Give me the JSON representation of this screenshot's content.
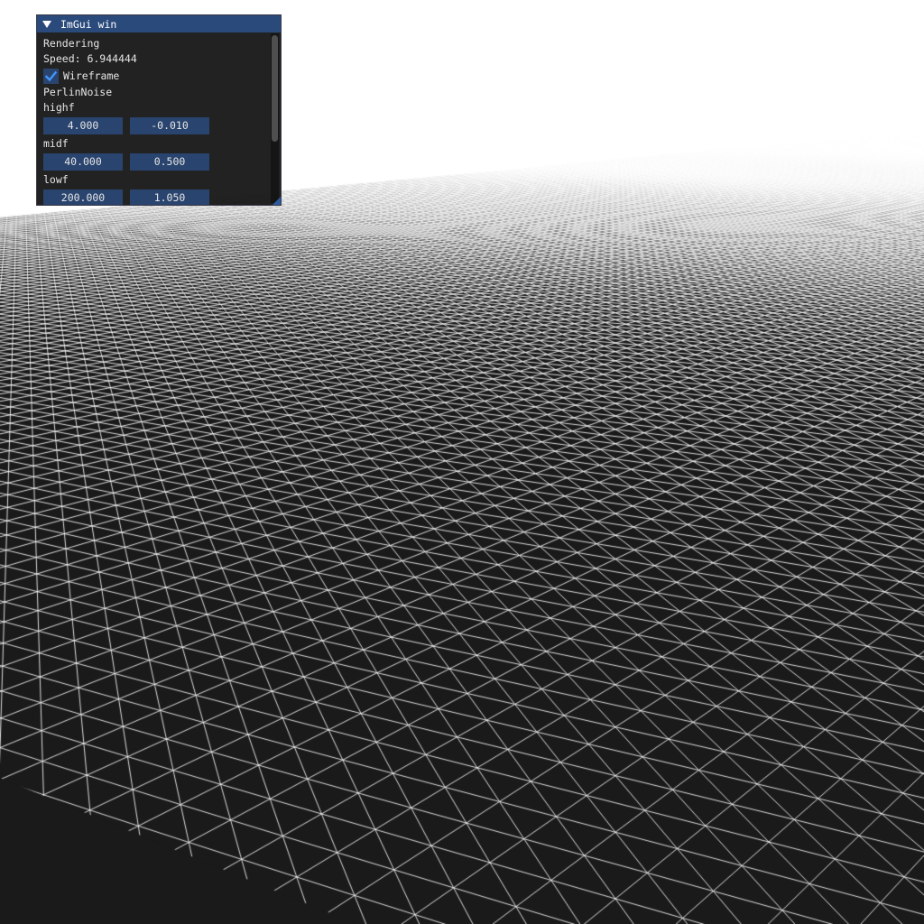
{
  "scene": {
    "background_color": "#ffffff",
    "mesh_fill_color": "#1a1a1a",
    "wire_color": "#ffffff"
  },
  "imgui_window": {
    "title": "ImGui win",
    "header_text": "Rendering",
    "speed_text": "Speed: 6.944444",
    "wireframe": {
      "label": "Wireframe",
      "checked": true
    },
    "section_label": "PerlinNoise",
    "params": [
      {
        "label": "highf",
        "value_a": "4.000",
        "value_b": "-0.010"
      },
      {
        "label": "midf",
        "value_a": "40.000",
        "value_b": "0.500"
      },
      {
        "label": "lowf",
        "value_a": "200.000",
        "value_b": "1.050"
      }
    ],
    "colors": {
      "title_bg": "#294a7a",
      "window_bg": "#141414",
      "frame_bg": "#29446e",
      "check_mark": "#4296fa"
    }
  }
}
